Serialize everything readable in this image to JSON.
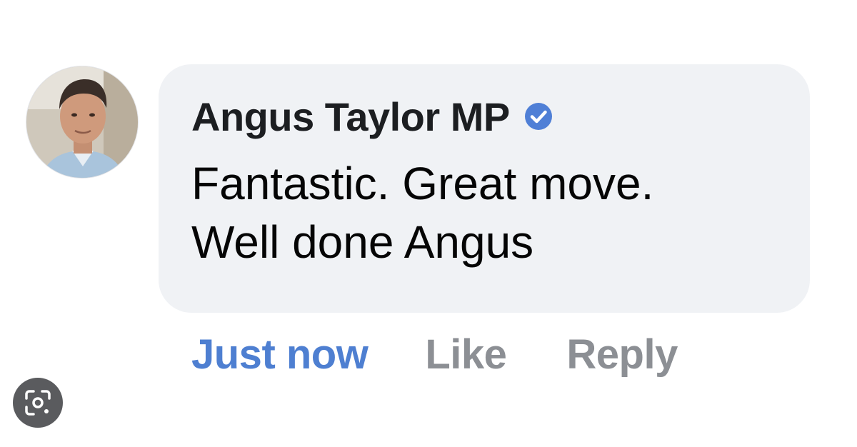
{
  "comment": {
    "author": "Angus Taylor MP",
    "verified_icon": "verified-badge-icon",
    "text": "Fantastic. Great move.\nWell done Angus",
    "avatar_icon": "profile-photo"
  },
  "actions": {
    "timestamp": "Just now",
    "like_label": "Like",
    "reply_label": "Reply"
  },
  "overlay": {
    "lens_icon": "visual-search-icon"
  },
  "colors": {
    "bubble": "#f0f2f5",
    "author": "#1c1e21",
    "timestamp": "#4e7fd1",
    "action": "#8c8f94",
    "verified": "#4f7fd6"
  }
}
